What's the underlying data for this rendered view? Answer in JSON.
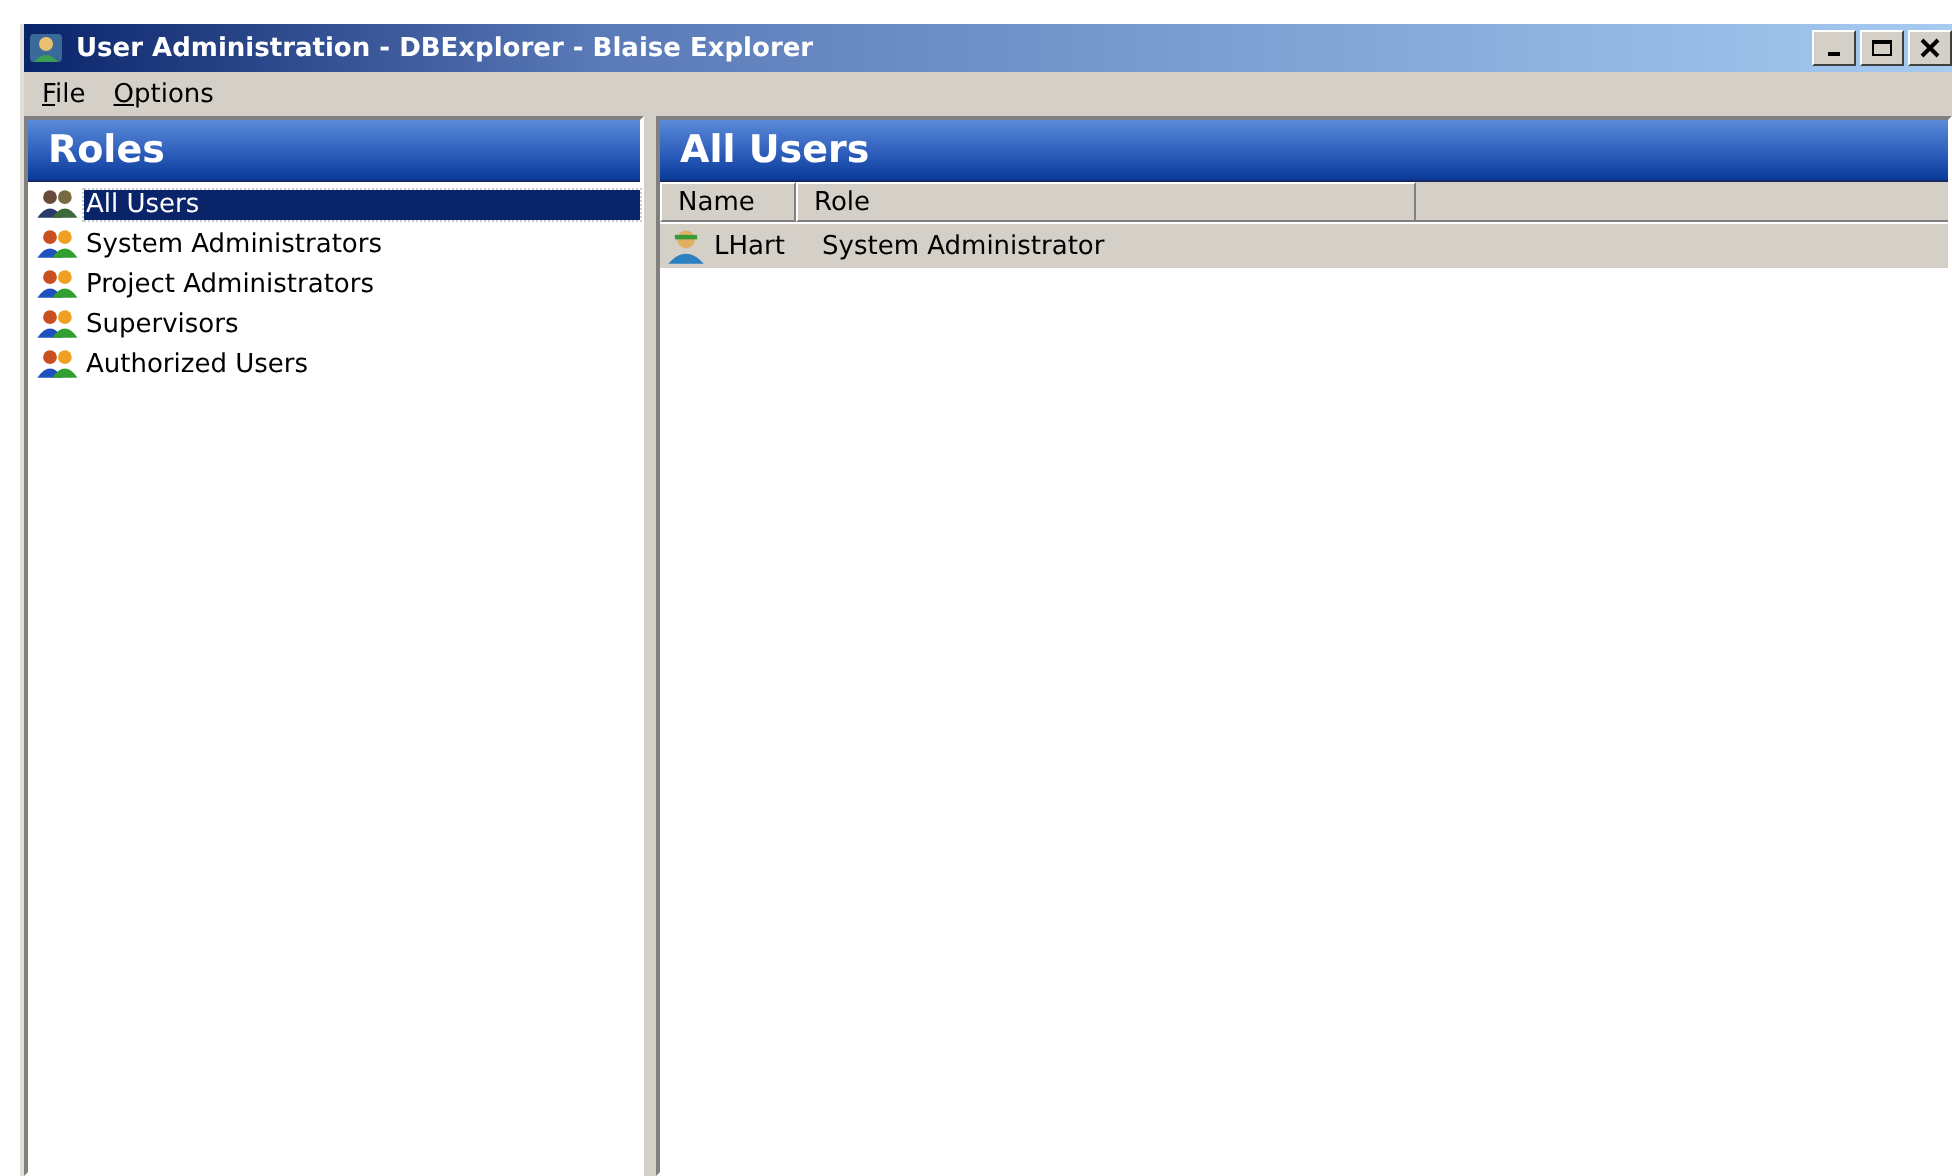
{
  "window": {
    "title": "User Administration - DBExplorer - Blaise Explorer"
  },
  "menu": [
    "File",
    "Options"
  ],
  "roles_panel": {
    "title": "Roles",
    "items": [
      {
        "label": "All Users",
        "selected": true
      },
      {
        "label": "System Administrators",
        "selected": false
      },
      {
        "label": "Project Administrators",
        "selected": false
      },
      {
        "label": "Supervisors",
        "selected": false
      },
      {
        "label": "Authorized Users",
        "selected": false
      }
    ]
  },
  "users_panel": {
    "title": "All Users",
    "columns": [
      "Name",
      "Role"
    ],
    "rows": [
      {
        "name": "LHart",
        "role": "System Administrator",
        "selected": true
      }
    ]
  }
}
